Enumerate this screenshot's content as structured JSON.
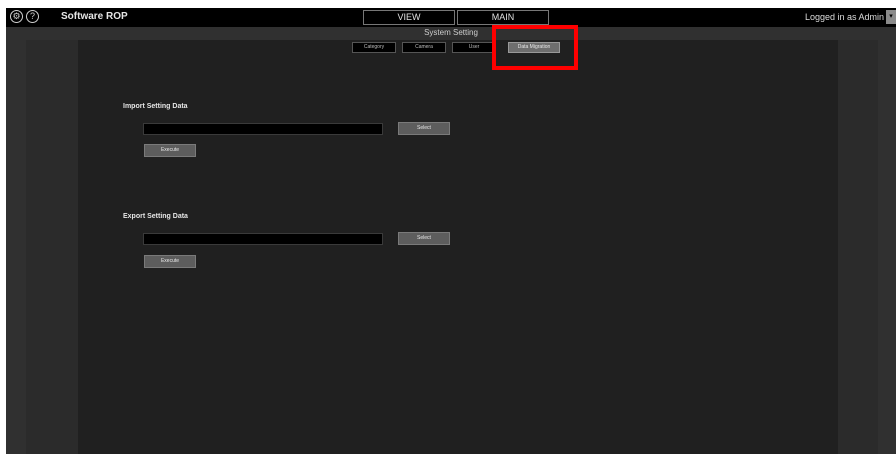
{
  "app": {
    "title": "Software ROP"
  },
  "header": {
    "settings_icon": "gear-icon",
    "help_icon_glyph": "?",
    "tabs": {
      "view": "VIEW",
      "main": "MAIN"
    },
    "login_status": "Logged in as Admin",
    "user_menu_glyph": "▾"
  },
  "system_setting": {
    "title": "System Setting",
    "tabs": [
      "Category",
      "Camera",
      "User",
      "Data Migration"
    ],
    "active_tab": "Data Migration",
    "highlight_color": "#ff0000"
  },
  "import": {
    "title": "Import Setting Data",
    "path_value": "",
    "select_label": "Select",
    "execute_label": "Execute"
  },
  "export": {
    "title": "Export Setting Data",
    "path_value": "",
    "select_label": "Select",
    "execute_label": "Execute"
  }
}
